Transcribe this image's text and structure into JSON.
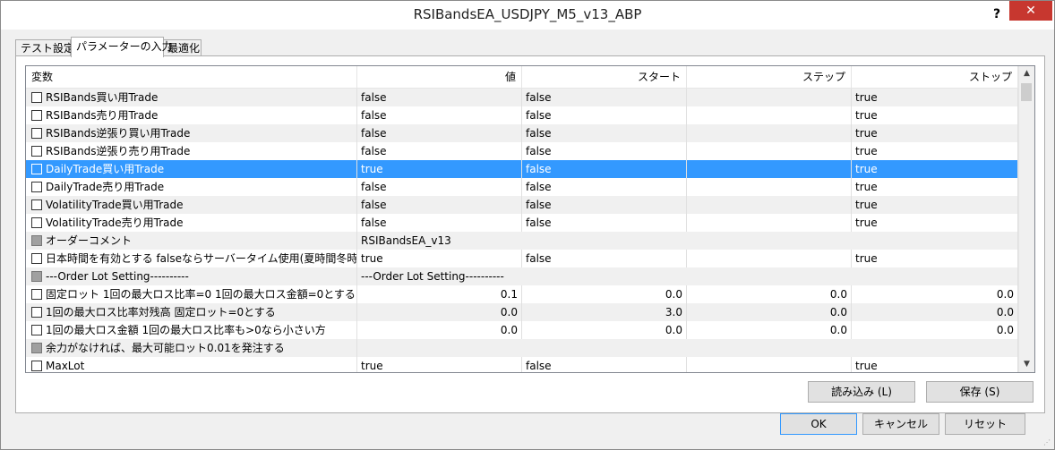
{
  "window": {
    "title": "RSIBandsEA_USDJPY_M5_v13_ABP",
    "help": "?",
    "close": "✕"
  },
  "tabs": [
    {
      "label": "テスト設定"
    },
    {
      "label": "パラメーターの入力"
    },
    {
      "label": "最適化"
    }
  ],
  "grid": {
    "columns": [
      "変数",
      "値",
      "スタート",
      "ステップ",
      "ストップ"
    ],
    "rows": [
      {
        "name": "RSIBands買い用Trade",
        "value": "false",
        "start": "false",
        "step": "",
        "stop": "true",
        "numeric": false,
        "disabled": false,
        "selected": false
      },
      {
        "name": "RSIBands売り用Trade",
        "value": "false",
        "start": "false",
        "step": "",
        "stop": "true",
        "numeric": false,
        "disabled": false,
        "selected": false
      },
      {
        "name": "RSIBands逆張り買い用Trade",
        "value": "false",
        "start": "false",
        "step": "",
        "stop": "true",
        "numeric": false,
        "disabled": false,
        "selected": false
      },
      {
        "name": "RSIBands逆張り売り用Trade",
        "value": "false",
        "start": "false",
        "step": "",
        "stop": "true",
        "numeric": false,
        "disabled": false,
        "selected": false
      },
      {
        "name": "DailyTrade買い用Trade",
        "value": "true",
        "start": "false",
        "step": "",
        "stop": "true",
        "numeric": false,
        "disabled": false,
        "selected": true
      },
      {
        "name": "DailyTrade売り用Trade",
        "value": "false",
        "start": "false",
        "step": "",
        "stop": "true",
        "numeric": false,
        "disabled": false,
        "selected": false
      },
      {
        "name": "VolatilityTrade買い用Trade",
        "value": "false",
        "start": "false",
        "step": "",
        "stop": "true",
        "numeric": false,
        "disabled": false,
        "selected": false
      },
      {
        "name": "VolatilityTrade売り用Trade",
        "value": "false",
        "start": "false",
        "step": "",
        "stop": "true",
        "numeric": false,
        "disabled": false,
        "selected": false
      },
      {
        "name": "オーダーコメント",
        "value": "RSIBandsEA_v13",
        "start": "",
        "step": "",
        "stop": "",
        "numeric": false,
        "disabled": true,
        "selected": false,
        "span": true
      },
      {
        "name": "日本時間を有効とする falseならサーバータイム使用(夏時間冬時間…",
        "value": "true",
        "start": "false",
        "step": "",
        "stop": "true",
        "numeric": false,
        "disabled": false,
        "selected": false
      },
      {
        "name": "---Order Lot Setting----------",
        "value": "---Order Lot Setting----------",
        "start": "",
        "step": "",
        "stop": "",
        "numeric": false,
        "disabled": true,
        "selected": false,
        "span": true
      },
      {
        "name": "固定ロット 1回の最大ロス比率=0 1回の最大ロス金額=0とする",
        "value": "0.1",
        "start": "0.0",
        "step": "0.0",
        "stop": "0.0",
        "numeric": true,
        "disabled": false,
        "selected": false
      },
      {
        "name": "1回の最大ロス比率対残高 固定ロット=0とする",
        "value": "0.0",
        "start": "3.0",
        "step": "0.0",
        "stop": "0.0",
        "numeric": true,
        "disabled": false,
        "selected": false
      },
      {
        "name": "1回の最大ロス金額 1回の最大ロス比率も>0なら小さい方",
        "value": "0.0",
        "start": "0.0",
        "step": "0.0",
        "stop": "0.0",
        "numeric": true,
        "disabled": false,
        "selected": false
      },
      {
        "name": "余力がなければ、最大可能ロット0.01を発注する",
        "value": "",
        "start": "",
        "step": "",
        "stop": "",
        "numeric": false,
        "disabled": true,
        "selected": false,
        "span": true
      },
      {
        "name": "MaxLot",
        "value": "true",
        "start": "false",
        "step": "",
        "stop": "true",
        "numeric": false,
        "disabled": false,
        "selected": false
      }
    ]
  },
  "buttons": {
    "load": "読み込み (L)",
    "save": "保存 (S)",
    "ok": "OK",
    "cancel": "キャンセル",
    "reset": "リセット"
  },
  "colors": {
    "selection": "#3399ff",
    "close": "#c7372f"
  }
}
